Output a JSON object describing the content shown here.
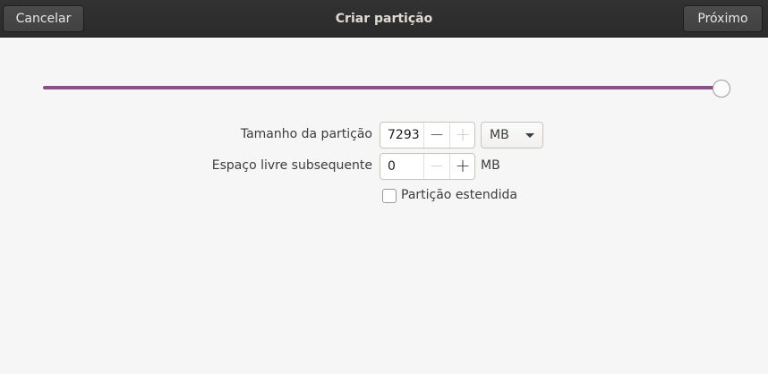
{
  "header": {
    "title": "Criar partição",
    "cancel_label": "Cancelar",
    "next_label": "Próximo"
  },
  "slider": {
    "value_fraction": 1.0,
    "accent_color": "#8a5185"
  },
  "form": {
    "partition_size": {
      "label": "Tamanho da partição",
      "value": "7293",
      "minus": "−",
      "plus": "+",
      "unit_selected": "MB"
    },
    "free_space_after": {
      "label": "Espaço livre subsequente",
      "value": "0",
      "minus": "−",
      "plus": "+",
      "unit": "MB"
    },
    "extended_partition": {
      "label": "Partição estendida",
      "checked": false
    }
  }
}
